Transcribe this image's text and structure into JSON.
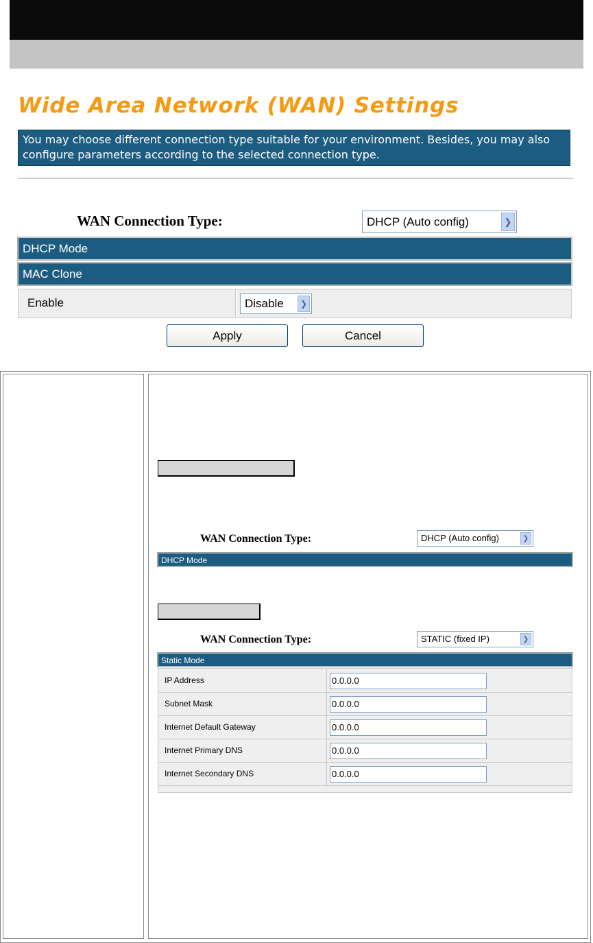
{
  "page": {
    "title": "Wide Area Network (WAN) Settings",
    "description": "You may choose different connection type suitable for your environment. Besides, you may also configure parameters according to the selected connection type."
  },
  "wan": {
    "connection_type_label": "WAN Connection Type:",
    "connection_type_value": "DHCP (Auto config)",
    "dhcp_mode_label": "DHCP Mode",
    "mac_clone_label": "MAC Clone",
    "enable_label": "Enable",
    "enable_value": "Disable",
    "apply_label": "Apply",
    "cancel_label": "Cancel"
  },
  "lower": {
    "dhcp_example": {
      "connection_type_label": "WAN Connection Type:",
      "connection_type_value": "DHCP (Auto config)",
      "mode_label": "DHCP Mode"
    },
    "static_example": {
      "connection_type_label": "WAN Connection Type:",
      "connection_type_value": "STATIC (fixed IP)",
      "mode_label": "Static Mode",
      "rows": [
        {
          "label": "IP Address",
          "value": "0.0.0.0"
        },
        {
          "label": "Subnet Mask",
          "value": "0.0.0.0"
        },
        {
          "label": "Internet Default Gateway",
          "value": "0.0.0.0"
        },
        {
          "label": "Internet Primary DNS",
          "value": "0.0.0.0"
        },
        {
          "label": "Internet Secondary DNS",
          "value": "0.0.0.0"
        }
      ]
    }
  },
  "colors": {
    "title_orange": "#f59a12",
    "header_blue": "#1c5c80"
  }
}
